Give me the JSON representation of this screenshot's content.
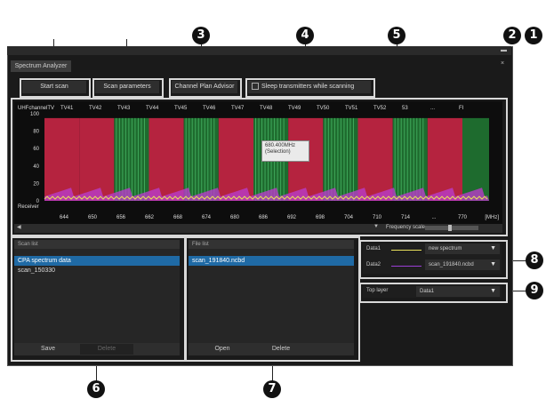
{
  "window": {
    "tab_title": "Spectrum Analyzer"
  },
  "toolbar": {
    "start_scan": "Start scan",
    "scan_parameters": "Scan parameters",
    "channel_plan_advisor": "Channel Plan Advisor",
    "sleep_transmitters": "Sleep transmitters while scanning"
  },
  "chart": {
    "channel_prefix": "UHFchannelTV",
    "channels": [
      "TV41",
      "TV42",
      "TV43",
      "TV44",
      "TV45",
      "TV46",
      "TV47",
      "TV48",
      "TV49",
      "TV50",
      "TV51",
      "TV52",
      "53",
      "...",
      "FI"
    ],
    "y_ticks": [
      "100",
      "80",
      "60",
      "40",
      "20",
      "0"
    ],
    "receiver_label": "Receiver",
    "x_ticks": [
      "644",
      "650",
      "656",
      "662",
      "668",
      "674",
      "680",
      "686",
      "692",
      "698",
      "704",
      "710",
      "714",
      "...",
      "770"
    ],
    "x_unit": "[MHz]",
    "tooltip_line1": "680.400MHz",
    "tooltip_line2": "(Selection)",
    "frequency_scale_label": "Frequency scale"
  },
  "chart_data": {
    "type": "bar",
    "ylim": [
      0,
      100
    ],
    "xlabel": "[MHz]",
    "categories": [
      "TV41",
      "TV42",
      "TV43",
      "TV44",
      "TV45",
      "TV46",
      "TV47",
      "TV48",
      "TV49",
      "TV50",
      "TV51",
      "TV52"
    ],
    "series": [
      {
        "values": [
          95,
          95,
          0,
          95,
          0,
          95,
          0,
          95,
          0,
          95,
          0,
          95
        ]
      }
    ]
  },
  "scan_list": {
    "header": "Scan list",
    "items": [
      "CPA spectrum data",
      "scan_150330"
    ],
    "save_label": "Save",
    "delete_label": "Delete"
  },
  "file_list": {
    "header": "File list",
    "items": [
      "scan_191840.ncbd"
    ],
    "open_label": "Open",
    "delete_label": "Delete"
  },
  "data_settings": {
    "data1_label": "Data1",
    "data1_value": "new spectrum",
    "data2_label": "Data2",
    "data2_value": "scan_191840.ncbd",
    "top_layer_label": "Top layer",
    "top_layer_value": "Data1"
  },
  "callouts": [
    "1",
    "2",
    "3",
    "4",
    "5",
    "6",
    "7",
    "8",
    "9"
  ],
  "colors": {
    "occupied": "#b5233f",
    "free": "#1e6b2e",
    "data1_trace": "#e8e05a",
    "data2_trace": "#9b3fd6",
    "selection": "#1f6aa5"
  }
}
